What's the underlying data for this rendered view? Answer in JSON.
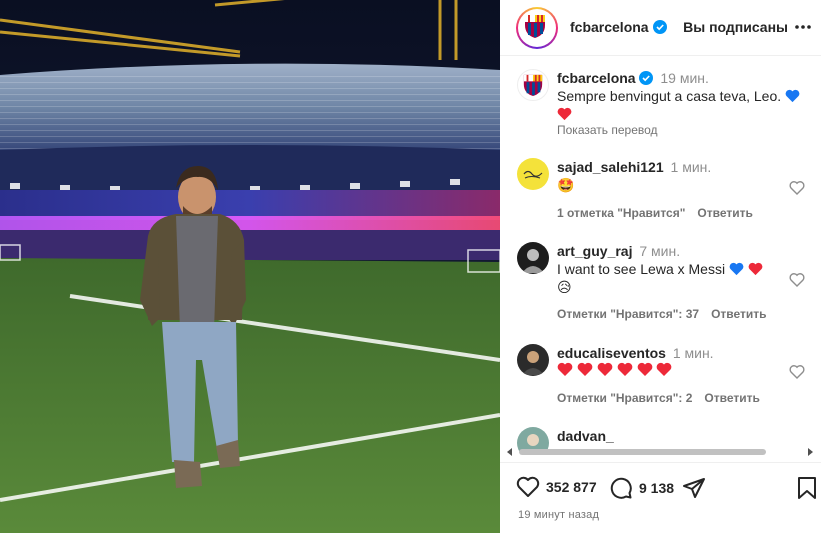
{
  "header": {
    "username": "fcbarcelona",
    "follow_state": "Вы подписаны"
  },
  "caption": {
    "username": "fcbarcelona",
    "time": "19 мин.",
    "text": "Sempre benvingut a casa teva, Leo.",
    "translate_label": "Показать перевод"
  },
  "comments": [
    {
      "username": "sajad_salehi121",
      "time": "1 мин.",
      "text": "🤩",
      "likes": "1 отметка \"Нравится\"",
      "reply": "Ответить"
    },
    {
      "username": "art_guy_raj",
      "time": "7 мин.",
      "text": "I want to see Lewa x Messi",
      "text2": "😥",
      "likes": "Отметки \"Нравится\": 37",
      "reply": "Ответить"
    },
    {
      "username": "educaliseventos",
      "time": "1 мин.",
      "text": "",
      "likes": "Отметки \"Нравится\": 2",
      "reply": "Ответить"
    },
    {
      "username": "dadvan_"
    }
  ],
  "actions": {
    "likes_count": "352 877",
    "comments_count": "9 138"
  },
  "timestamp": "19 минут назад",
  "colors": {
    "verified": "#0095f6",
    "heart_blue": "#1877f2",
    "heart_red": "#ed2939",
    "muted": "#737373"
  }
}
